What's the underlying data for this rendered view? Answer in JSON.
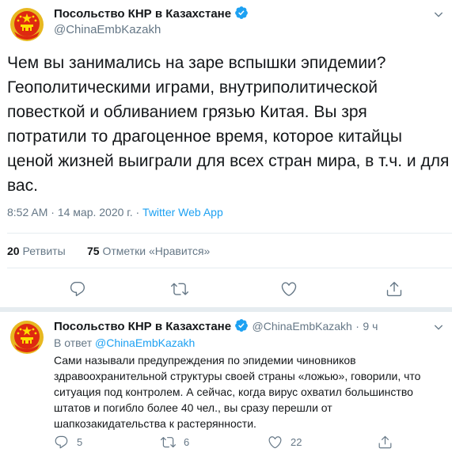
{
  "tweet": {
    "author_name": "Посольство КНР в Казахстане",
    "author_handle": "@ChinaEmbKazakh",
    "text": "Чем вы занимались на заре вспышки эпидемии? Геополитическими играми, внутриполитической повесткой и обливанием грязью Китая. Вы зря потратили то драгоценное время, которое китайцы ценой жизней выиграли для всех стран мира, в т.ч. и для вас.",
    "time": "8:52 AM",
    "date": "14 мар. 2020 г.",
    "separator": "·",
    "source": "Twitter Web App",
    "retweets_count": "20",
    "retweets_label": "Ретвиты",
    "likes_count": "75",
    "likes_label": "Отметки «Нравится»"
  },
  "reply": {
    "author_name": "Посольство КНР в Казахстане",
    "author_handle": "@ChinaEmbKazakh",
    "separator": "·",
    "age": "9 ч",
    "replying_prefix": "В ответ",
    "replying_to": "@ChinaEmbKazakh",
    "text": "Сами называли предупреждения по эпидемии чиновников здравоохранительной структуры своей страны «ложью», говорили, что ситуация под контролем. А сейчас, когда вирус охватил большинство штатов и погибло более 40 чел., вы сразу перешли от шапкозакидательства к растерянности.",
    "reply_count": "5",
    "retweet_count": "6",
    "like_count": "22"
  },
  "icons": {
    "avatar": "china-national-emblem",
    "verified": "verified-badge-icon",
    "reply": "reply-icon",
    "retweet": "retweet-icon",
    "like": "heart-icon",
    "share": "share-icon",
    "more": "chevron-down-icon"
  },
  "colors": {
    "accent": "#1da1f2",
    "secondary_text": "#657786",
    "emblem_red": "#de2910",
    "emblem_gold": "#ffde00"
  }
}
